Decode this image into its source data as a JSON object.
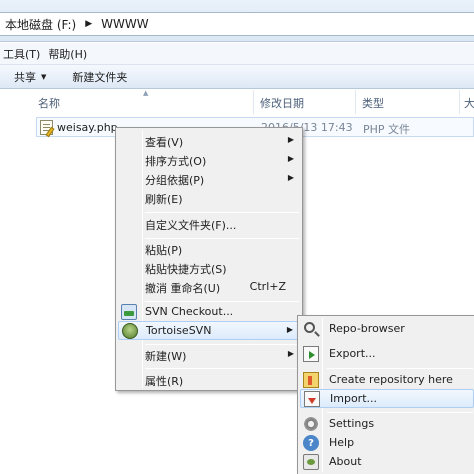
{
  "address": {
    "segments": [
      "本地磁盘 (F:)",
      "WWWW"
    ],
    "separator": "▶"
  },
  "menubar": {
    "items": [
      "工具(T)",
      "帮助(H)"
    ]
  },
  "toolbar": {
    "share_label": "共享",
    "new_folder_label": "新建文件夹"
  },
  "columns": {
    "name": "名称",
    "modified": "修改日期",
    "type": "类型",
    "size": "大"
  },
  "file": {
    "name": "weisay.php",
    "modified": "2016/5/13 17:43",
    "type": "PHP 文件"
  },
  "context_menu": {
    "view": "查看(V)",
    "sort_by": "排序方式(O)",
    "group_by": "分组依据(P)",
    "refresh": "刷新(E)",
    "customize": "自定义文件夹(F)...",
    "paste": "粘贴(P)",
    "paste_shortcut": "粘贴快捷方式(S)",
    "undo_rename": "撤消 重命名(U)",
    "undo_shortcut": "Ctrl+Z",
    "svn_checkout": "SVN Checkout...",
    "tortoise_svn": "TortoiseSVN",
    "new": "新建(W)",
    "properties": "属性(R)"
  },
  "submenu": {
    "repo_browser": "Repo-browser",
    "export": "Export...",
    "create_repo": "Create repository here",
    "import": "Import...",
    "settings": "Settings",
    "help": "Help",
    "about": "About"
  },
  "icons": {
    "help_glyph": "?",
    "submenu_arrow": "▶",
    "toolbar_caret": "▼",
    "sort_arrow": "▲"
  }
}
